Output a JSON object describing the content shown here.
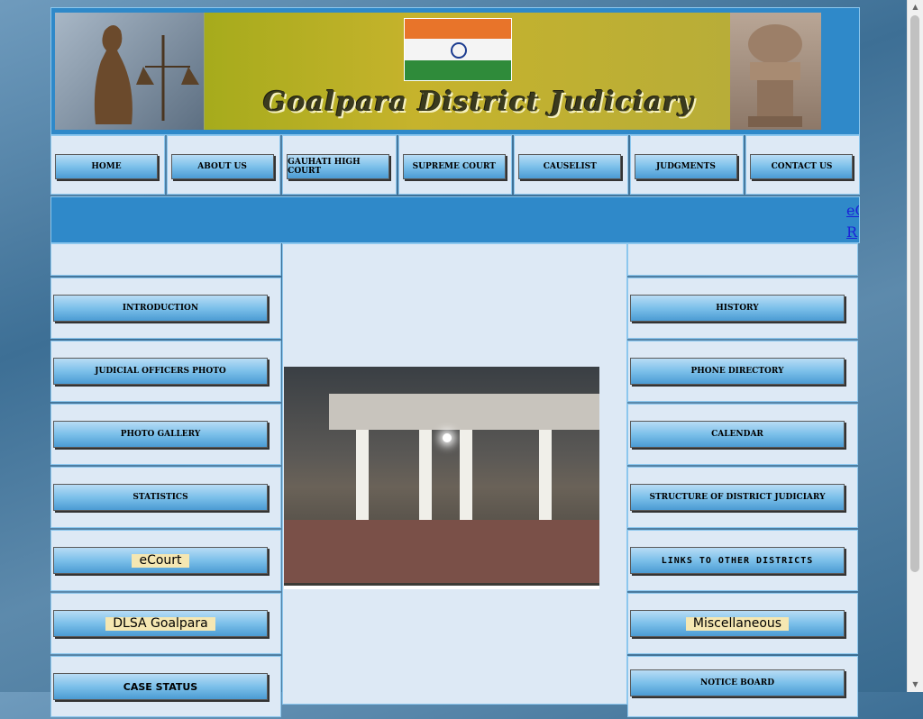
{
  "banner": {
    "title": "Goalpara District Judiciary"
  },
  "nav": {
    "items": [
      {
        "label": "HOME"
      },
      {
        "label": "ABOUT US"
      },
      {
        "label": "GAUHATI HIGH COURT"
      },
      {
        "label": "SUPREME COURT"
      },
      {
        "label": "CAUSELIST"
      },
      {
        "label": "JUDGMENTS"
      },
      {
        "label": "CONTACT US"
      }
    ]
  },
  "ticker": {
    "line1": "eC",
    "line2": "R"
  },
  "left_menu": {
    "items": [
      {
        "label": "INTRODUCTION"
      },
      {
        "label": "JUDICIAL OFFICERS PHOTO"
      },
      {
        "label": "PHOTO GALLERY"
      },
      {
        "label": "STATISTICS"
      },
      {
        "label": "eCourt"
      },
      {
        "label": "DLSA Goalpara"
      },
      {
        "label": "CASE STATUS"
      }
    ]
  },
  "right_menu": {
    "items": [
      {
        "label": "HISTORY"
      },
      {
        "label": "PHONE DIRECTORY"
      },
      {
        "label": "CALENDAR"
      },
      {
        "label": "STRUCTURE OF DISTRICT JUDICIARY"
      },
      {
        "label": "LINKS TO OTHER DISTRICTS"
      },
      {
        "label": "Miscellaneous"
      },
      {
        "label": "NOTICE BOARD"
      }
    ]
  },
  "icons": {
    "scroll_up": "scroll-up-arrow-icon",
    "scroll_down": "scroll-down-arrow-icon"
  },
  "colors": {
    "banner_bg": "#2f89c9",
    "cell_bg": "#dde9f5",
    "link": "#1a22d8"
  }
}
